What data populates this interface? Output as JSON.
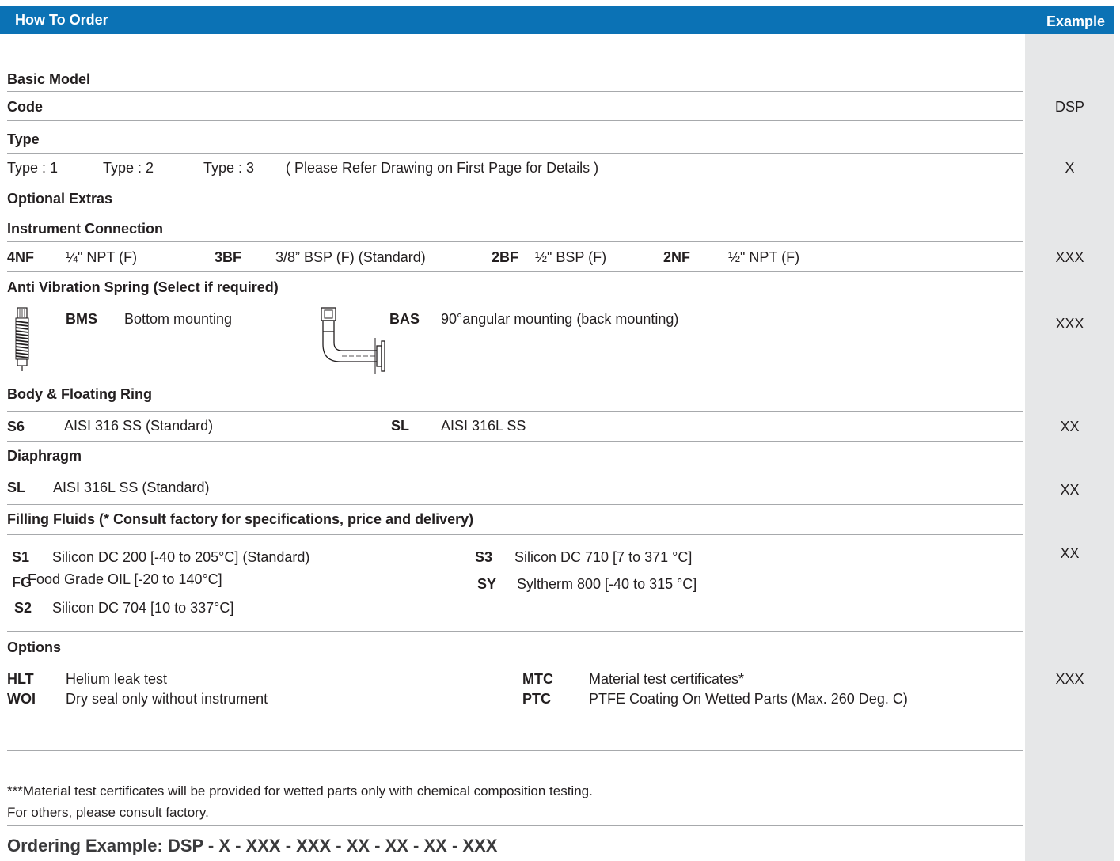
{
  "header": {
    "title": "How To Order",
    "example": "Example"
  },
  "basic_model": {
    "heading": "Basic Model",
    "code_label": "Code",
    "code_example": "DSP"
  },
  "type": {
    "heading": "Type",
    "opt1": "Type : 1",
    "opt2": "Type : 2",
    "opt3": "Type : 3",
    "note": "( Please Refer Drawing on First Page for Details )",
    "example": "X"
  },
  "optional_extras": {
    "heading": "Optional Extras"
  },
  "instrument_connection": {
    "heading": "Instrument Connection",
    "items": [
      {
        "code": "4NF",
        "desc": "¼\" NPT (F)"
      },
      {
        "code": "3BF",
        "desc": "3/8” BSP (F) (Standard)"
      },
      {
        "code": "2BF",
        "desc": "½\" BSP (F)"
      },
      {
        "code": "2NF",
        "desc": "½\" NPT (F)"
      }
    ],
    "example": "XXX"
  },
  "anti_vibration": {
    "heading": "Anti Vibration Spring (Select if required)",
    "items": [
      {
        "code": "BMS",
        "desc": "Bottom mounting"
      },
      {
        "code": "BAS",
        "desc": "90°angular mounting (back mounting)"
      }
    ],
    "example": "XXX"
  },
  "body_ring": {
    "heading": "Body & Floating Ring",
    "items": [
      {
        "code": "S6",
        "desc": "AISI 316 SS (Standard)"
      },
      {
        "code": "SL",
        "desc": "AISI 316L SS"
      }
    ],
    "example": "XX"
  },
  "diaphragm": {
    "heading": "Diaphragm",
    "items": [
      {
        "code": "SL",
        "desc": "AISI 316L SS (Standard)"
      }
    ],
    "example": "XX"
  },
  "filling_fluids": {
    "heading": "Filling Fluids (* Consult factory for specifications, price and delivery)",
    "items": [
      {
        "code": "S1",
        "desc": "Silicon DC 200 [-40 to 205°C] (Standard)"
      },
      {
        "code": "FG",
        "desc": "Food Grade  OIL [-20 to 140°C]"
      },
      {
        "code": "S2",
        "desc": "Silicon DC 704 [10 to 337°C]"
      },
      {
        "code": "S3",
        "desc": "Silicon DC 710 [7 to 371 °C]"
      },
      {
        "code": "SY",
        "desc": "Syltherm 800 [-40 to 315 °C]"
      }
    ],
    "example": "XX"
  },
  "options": {
    "heading": "Options",
    "items": [
      {
        "code": "HLT",
        "desc": "Helium leak test"
      },
      {
        "code": "WOI",
        "desc": "Dry seal only without instrument"
      },
      {
        "code": "MTC",
        "desc": "Material test certificates*"
      },
      {
        "code": "PTC",
        "desc": "PTFE Coating On Wetted Parts (Max. 260 Deg. C)"
      }
    ],
    "example": "XXX"
  },
  "footnote": {
    "line1": "***Material test certificates will be provided for wetted parts only with chemical composition testing.",
    "line2": "For others, please consult factory."
  },
  "ordering_example": "Ordering Example: DSP - X - XXX - XXX - XX - XX - XX - XXX"
}
